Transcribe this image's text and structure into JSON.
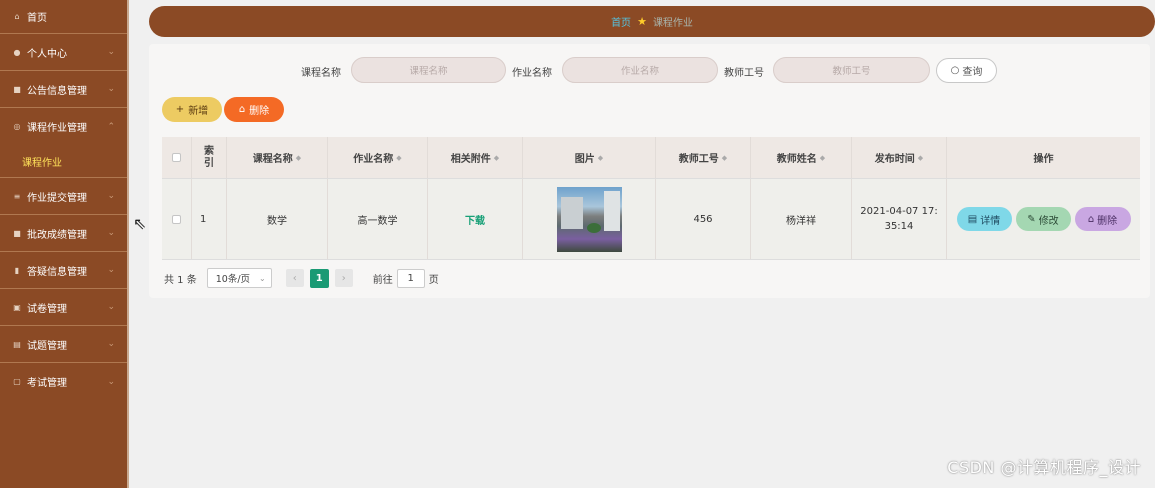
{
  "sidebar": {
    "home": {
      "label": "首页",
      "icon": "home-icon"
    },
    "items": [
      {
        "label": "个人中心",
        "icon": "user-icon"
      },
      {
        "label": "公告信息管理",
        "icon": "notice-icon"
      },
      {
        "label": "课程作业管理",
        "icon": "course-icon",
        "expanded": true
      },
      {
        "label": "作业提交管理",
        "icon": "list-icon"
      },
      {
        "label": "批改成绩管理",
        "icon": "grade-icon"
      },
      {
        "label": "答疑信息管理",
        "icon": "chart-icon"
      },
      {
        "label": "试卷管理",
        "icon": "paper-icon"
      },
      {
        "label": "试题管理",
        "icon": "question-icon"
      },
      {
        "label": "考试管理",
        "icon": "exam-icon"
      }
    ],
    "sub_active": "课程作业"
  },
  "breadcrumb": {
    "home": "首页",
    "current": "课程作业"
  },
  "search": {
    "course_label": "课程名称",
    "course_placeholder": "课程名称",
    "homework_label": "作业名称",
    "homework_placeholder": "作业名称",
    "teacher_label": "教师工号",
    "teacher_placeholder": "教师工号",
    "query_label": "查询"
  },
  "actions": {
    "add_label": "新增",
    "delete_label": "删除"
  },
  "table": {
    "headers": [
      "索引",
      "课程名称",
      "作业名称",
      "相关附件",
      "图片",
      "教师工号",
      "教师姓名",
      "发布时间",
      "操作"
    ],
    "rows": [
      {
        "index": "1",
        "course": "数学",
        "homework": "高一数学",
        "attachment": "下载",
        "teacher_no": "456",
        "teacher_name": "杨洋祥",
        "time": "2021-04-07 17:35:14"
      }
    ],
    "row_buttons": {
      "detail": "详情",
      "edit": "修改",
      "remove": "删除"
    }
  },
  "pager": {
    "total_text": "共 1 条",
    "page_size": "10条/页",
    "current_page": "1",
    "goto_prefix": "前往",
    "goto_value": "1",
    "goto_suffix": "页"
  },
  "watermark": "CSDN @计算机程序_设计",
  "colors": {
    "sidebar_bg": "#8b4a25",
    "accent_green": "#1a9a74",
    "add_btn": "#edcb62",
    "delete_btn": "#f46a25"
  }
}
